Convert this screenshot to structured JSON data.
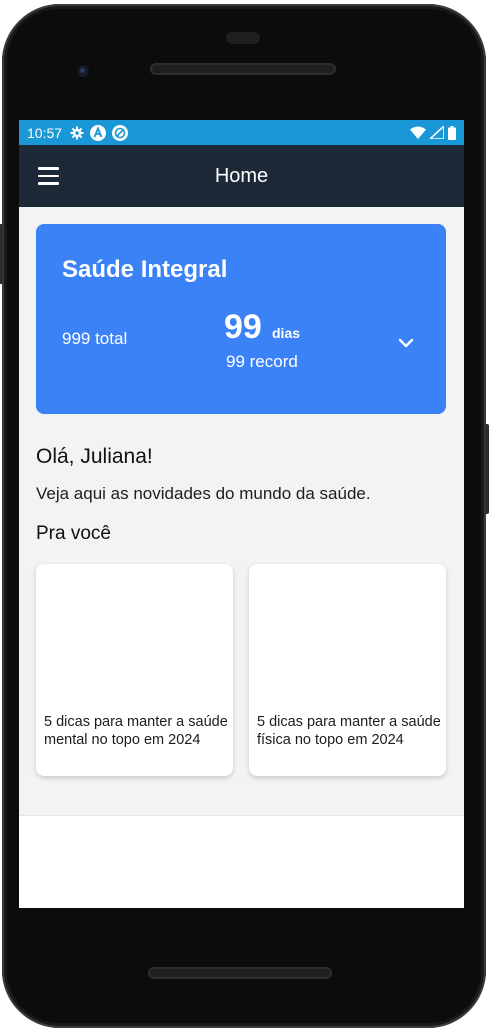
{
  "status_bar": {
    "time": "10:57",
    "left_icons": [
      "settings-icon",
      "app-a-icon",
      "at-sign-icon"
    ],
    "right_icons": [
      "wifi-icon",
      "cell-signal-icon",
      "battery-icon"
    ],
    "color": "#1a97d6"
  },
  "app_bar": {
    "title": "Home",
    "menu_icon": "hamburger-menu-icon",
    "color": "#1d2936"
  },
  "streak_card": {
    "title": "Saúde Integral",
    "total": "999 total",
    "days_value": "99",
    "days_unit": "dias",
    "record": "99 record",
    "expand_icon": "chevron-down-icon",
    "color": "#3b82f6"
  },
  "greeting": "Olá, Juliana!",
  "subtitle": "Veja aqui as novidades do mundo da saúde.",
  "section": {
    "title": "Pra você"
  },
  "articles": [
    {
      "title": "5 dicas para manter a saúde mental no topo em 2024"
    },
    {
      "title": "5 dicas para manter a saúde física no topo em 2024"
    }
  ],
  "nav_bar": {
    "buttons": [
      "back-icon",
      "home-icon",
      "recents-icon"
    ]
  }
}
